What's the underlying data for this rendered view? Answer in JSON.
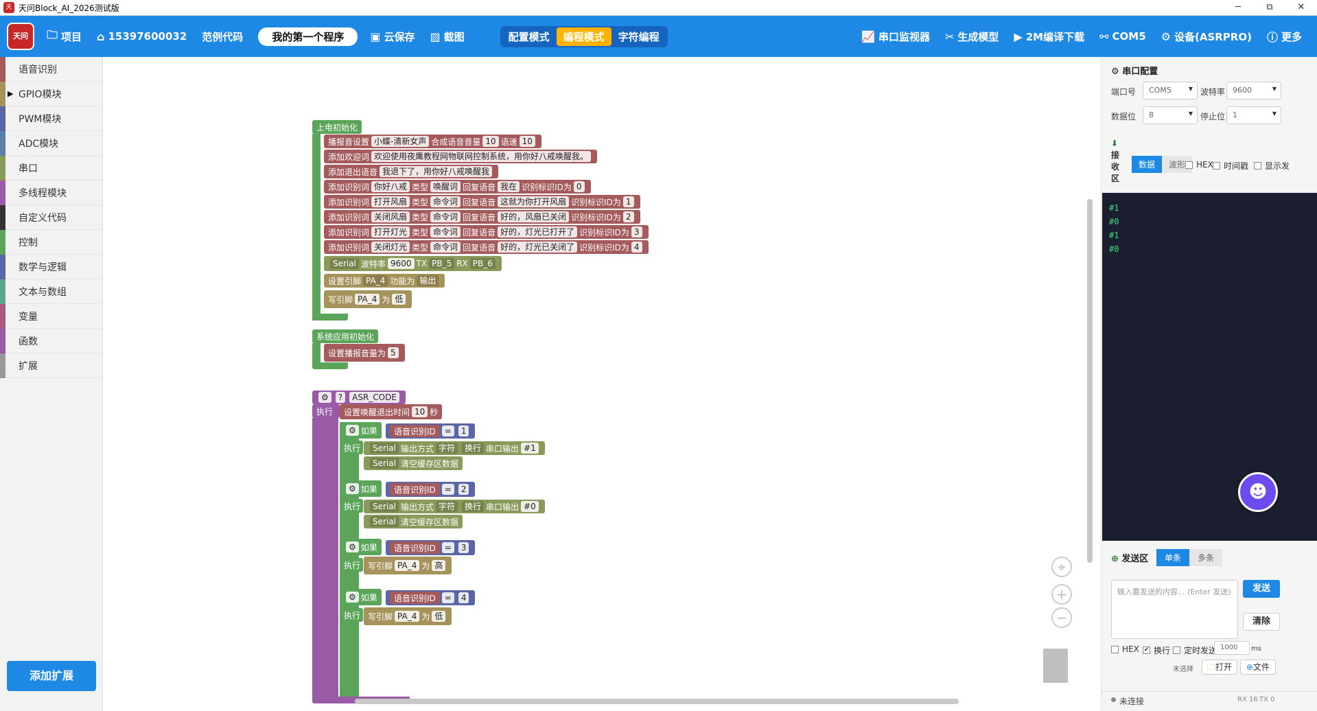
{
  "titlebar": {
    "title": "天问Block_AI_2026测试版",
    "min": "─",
    "max": "⧉",
    "close": "✕"
  },
  "toolbar": {
    "logo_text": "天问51",
    "project": "项目",
    "account": "15397600032",
    "examples": "范例代码",
    "program_name": "我的第一个程序",
    "cloud_save": "云保存",
    "screenshot": "截图",
    "modes": [
      "配置模式",
      "编程模式",
      "字符编程"
    ],
    "serial_monitor": "串口监视器",
    "generate_model": "生成模型",
    "compile_download": "2M编译下载",
    "port": "COM5",
    "device": "设备(ASRPRO)",
    "more": "更多"
  },
  "sidebar": {
    "categories": [
      {
        "label": "语音识别",
        "color": "#a55b5b"
      },
      {
        "label": "GPIO模块",
        "color": "#a5935b"
      },
      {
        "label": "PWM模块",
        "color": "#5b67a5"
      },
      {
        "label": "ADC模块",
        "color": "#5b80a5"
      },
      {
        "label": "串口",
        "color": "#8a9a5b"
      },
      {
        "label": "多线程模块",
        "color": "#995ba5"
      },
      {
        "label": "自定义代码",
        "color": "#333333"
      },
      {
        "label": "控制",
        "color": "#5ba55b"
      },
      {
        "label": "数学与逻辑",
        "color": "#5b67a5"
      },
      {
        "label": "文本与数组",
        "color": "#5ba58c"
      },
      {
        "label": "变量",
        "color": "#a55b80"
      },
      {
        "label": "函数",
        "color": "#995ba5"
      },
      {
        "label": "扩展",
        "color": "#999999"
      }
    ],
    "add_extension": "添加扩展"
  },
  "blocks": {
    "power_on": "上电初始化",
    "broadcast": {
      "t1": "播报音设置",
      "voice": "小蝶-清新女声",
      "t2": "合成语音音量",
      "vol": "10",
      "t3": "语速",
      "speed": "10"
    },
    "welcome": {
      "t": "添加欢迎词",
      "text": "欢迎使用夜鹰教程网物联网控制系统，用你好八戒唤醒我。"
    },
    "exit": {
      "t": "添加退出语音",
      "text": "我退下了，用你好八戒唤醒我"
    },
    "words": [
      {
        "word": "你好八戒",
        "type": "唤醒词",
        "reply": "我在",
        "id": "0"
      },
      {
        "word": "打开风扇",
        "type": "命令词",
        "reply": "这就为你打开风扇",
        "id": "1"
      },
      {
        "word": "关闭风扇",
        "type": "命令词",
        "reply": "好的，风扇已关闭",
        "id": "2"
      },
      {
        "word": "打开灯光",
        "type": "命令词",
        "reply": "好的，灯光已打开了",
        "id": "3"
      },
      {
        "word": "关闭灯光",
        "type": "命令词",
        "reply": "好的，灯光已关闭了",
        "id": "4"
      }
    ],
    "word_labels": {
      "add": "添加识别词",
      "type": "类型",
      "reply": "回复语音",
      "id": "识别标识ID为"
    },
    "serial_init": {
      "port": "Serial",
      "baud_label": "波特率",
      "baud": "9600",
      "tx_label": "TX",
      "tx": "PB_5",
      "rx_label": "RX",
      "rx": "PB_6"
    },
    "pin_mode": {
      "t1": "设置引脚",
      "pin": "PA_4",
      "t2": "功能为",
      "mode": "输出"
    },
    "write_pin": {
      "t1": "写引脚",
      "pin": "PA_4",
      "t2": "为",
      "low": "低",
      "high": "高"
    },
    "sys_init": "系统应用初始化",
    "set_volume": {
      "t": "设置播报音量为",
      "val": "5"
    },
    "asr_code": "ASR_CODE",
    "exec": "执行",
    "wake_timeout": {
      "t1": "设置唤醒退出时间",
      "val": "10",
      "t2": "秒"
    },
    "if_label": "如果",
    "asr_id": "语音识别ID",
    "eq": "=",
    "serial_out": {
      "port": "Serial",
      "t1": "输出方式",
      "fmt": "字符",
      "nl": "换行",
      "t2": "串口输出"
    },
    "clear_buf": "清空缓存区数据",
    "outs": [
      "#1",
      "#0"
    ],
    "if_ids": [
      "1",
      "2",
      "3",
      "4"
    ]
  },
  "serial_panel": {
    "title": "串口配置",
    "port_label": "端口号",
    "port": "COM5",
    "baud_label": "波特率",
    "baud": "9600",
    "data_label": "数据位",
    "data": "8",
    "stop_label": "停止位",
    "stop": "1",
    "recv_label": "接收区",
    "recv_tabs": [
      "数据",
      "波形"
    ],
    "hex": "HEX",
    "timestamp": "时间戳",
    "show": "显示发",
    "received": [
      "#1",
      "#0",
      "#1",
      "#0"
    ],
    "send_title": "发送区",
    "send_tabs": [
      "单条",
      "多条"
    ],
    "send_placeholder": "输入要发送的内容... (Enter 发送)",
    "send_btn": "发送",
    "clear_btn": "清除",
    "newline": "换行",
    "timed": "定时发送",
    "interval": "1000",
    "ms": "ms",
    "file_state": "未选择",
    "open_btn": "打开",
    "file_btn": "文件",
    "status": "未连接",
    "rx": "RX 16",
    "tx": "TX 0"
  }
}
